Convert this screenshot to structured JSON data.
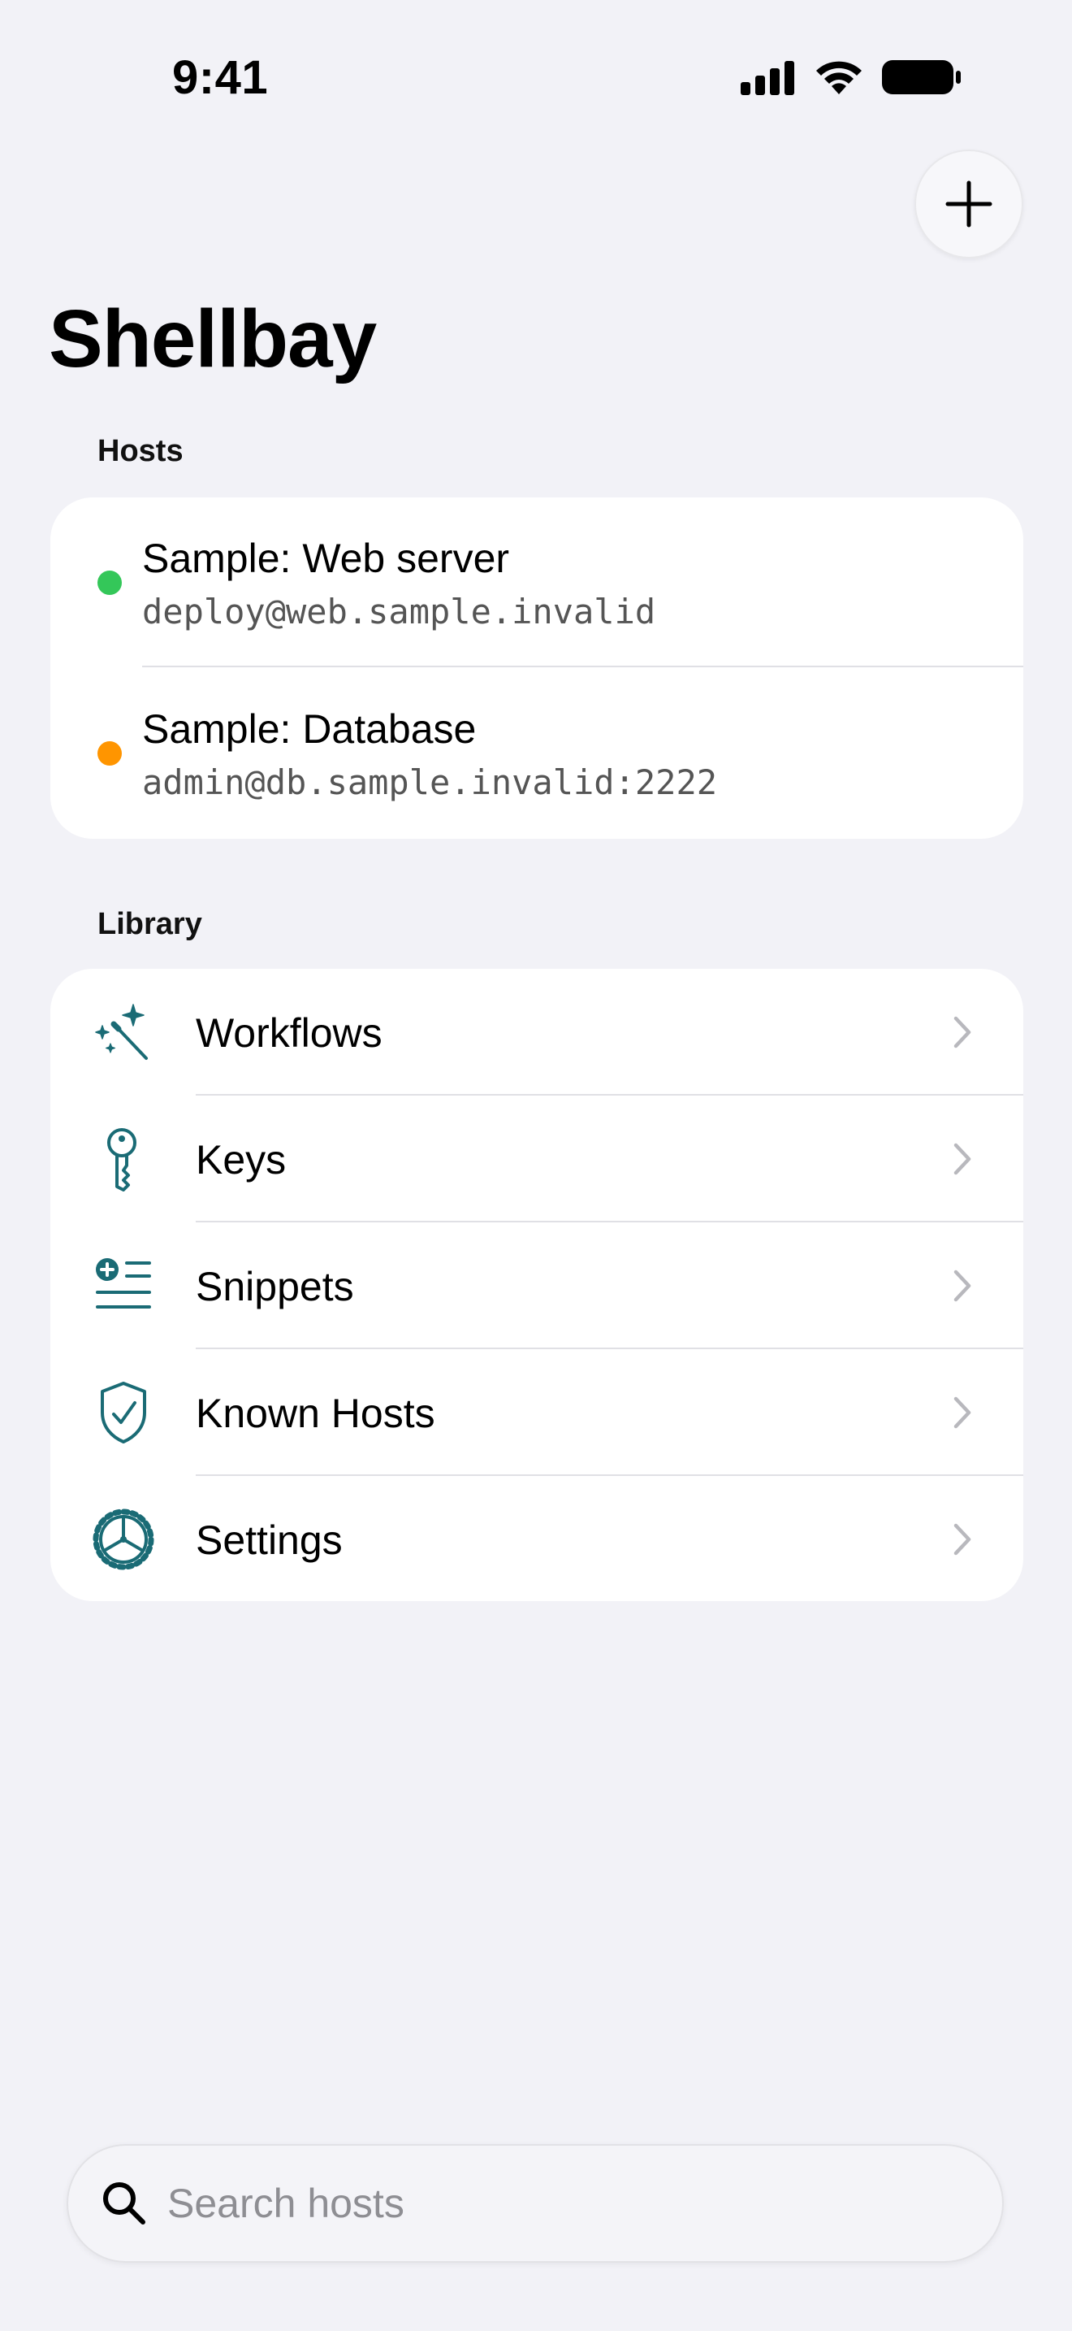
{
  "status_bar": {
    "time": "9:41",
    "icons": [
      "cellular-signal-icon",
      "wifi-icon",
      "battery-icon"
    ]
  },
  "header": {
    "title": "Shellbay",
    "add_icon": "plus-icon"
  },
  "hosts": {
    "section_label": "Hosts",
    "items": [
      {
        "name": "Sample: Web server",
        "address": "deploy@web.sample.invalid",
        "status_color": "#34C759"
      },
      {
        "name": "Sample: Database",
        "address": "admin@db.sample.invalid:2222",
        "status_color": "#FF9500"
      }
    ]
  },
  "library": {
    "section_label": "Library",
    "items": [
      {
        "label": "Workflows",
        "icon": "magic-wand-icon"
      },
      {
        "label": "Keys",
        "icon": "key-icon"
      },
      {
        "label": "Snippets",
        "icon": "snippet-list-icon"
      },
      {
        "label": "Known Hosts",
        "icon": "shield-check-icon"
      },
      {
        "label": "Settings",
        "icon": "gear-icon"
      }
    ]
  },
  "search": {
    "placeholder": "Search hosts",
    "value": ""
  },
  "colors": {
    "accent": "#1A6B75",
    "background": "#F2F2F7",
    "card": "#FFFFFF"
  }
}
